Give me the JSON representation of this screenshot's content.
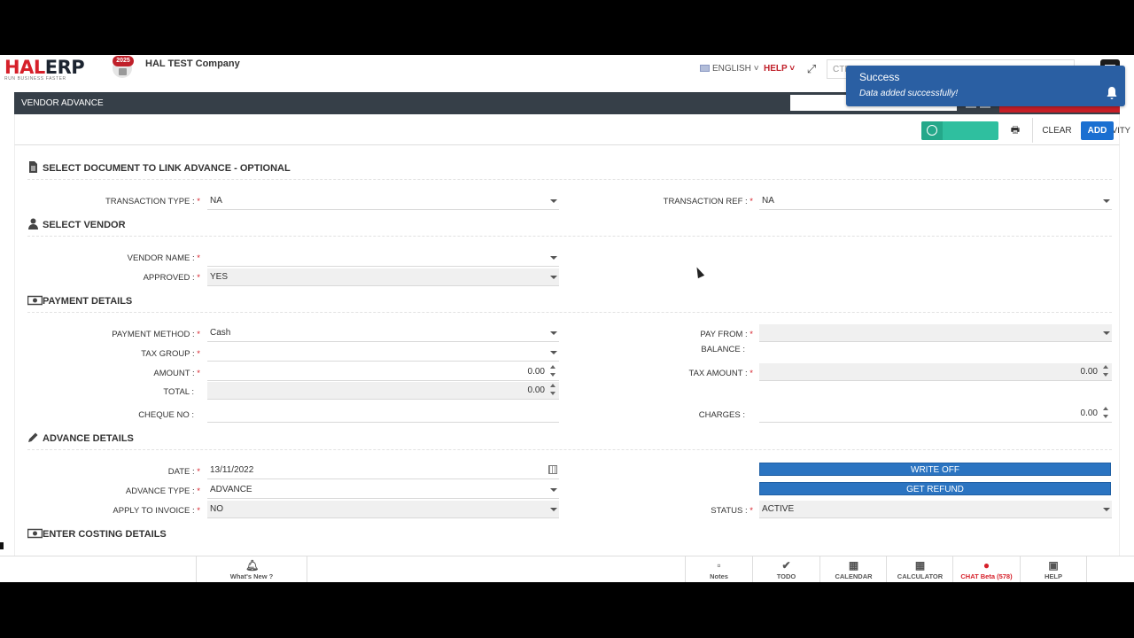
{
  "brand": {
    "logo_left": "HAL",
    "logo_right": "ERP",
    "tagline": "RUN BUSINESS FASTER",
    "year_badge": "2025",
    "company": "HAL TEST Company"
  },
  "topbar": {
    "language": "ENGLISH",
    "help": "HELP",
    "search_placeholder": "CTR"
  },
  "toast": {
    "title": "Success",
    "message": "Data added successfully!"
  },
  "module": {
    "title": "VENDOR ADVANCE"
  },
  "actions": {
    "activity": "ACTIVITY",
    "clear": "CLEAR",
    "add": "ADD"
  },
  "sections": {
    "link_doc": "SELECT DOCUMENT TO LINK ADVANCE - OPTIONAL",
    "vendor": "SELECT VENDOR",
    "payment": "PAYMENT DETAILS",
    "advance": "ADVANCE DETAILS",
    "costing": "ENTER COSTING DETAILS"
  },
  "fields": {
    "transaction_type": {
      "label": "TRANSACTION TYPE :",
      "value": "NA"
    },
    "transaction_ref": {
      "label": "TRANSACTION REF :",
      "value": "NA"
    },
    "vendor_name": {
      "label": "VENDOR NAME :",
      "value": ""
    },
    "approved": {
      "label": "APPROVED :",
      "value": "YES"
    },
    "payment_method": {
      "label": "PAYMENT METHOD :",
      "value": "Cash"
    },
    "pay_from": {
      "label": "PAY FROM :",
      "value": ""
    },
    "balance": {
      "label": "BALANCE :"
    },
    "tax_group": {
      "label": "TAX GROUP :",
      "value": ""
    },
    "amount": {
      "label": "AMOUNT :",
      "value": "0.00"
    },
    "tax_amount": {
      "label": "TAX AMOUNT :",
      "value": "0.00"
    },
    "total": {
      "label": "TOTAL :",
      "value": "0.00"
    },
    "cheque_no": {
      "label": "CHEQUE NO :",
      "value": ""
    },
    "charges": {
      "label": "CHARGES :",
      "value": "0.00"
    },
    "date": {
      "label": "DATE :",
      "value": "13/11/2022"
    },
    "advance_type": {
      "label": "ADVANCE TYPE :",
      "value": "ADVANCE"
    },
    "apply_to_invoice": {
      "label": "APPLY TO INVOICE :",
      "value": "NO"
    },
    "status": {
      "label": "STATUS :",
      "value": "ACTIVE"
    }
  },
  "buttons": {
    "write_off": "WRITE OFF",
    "get_refund": "GET REFUND"
  },
  "bottombar": {
    "whats_new": "What's New ?",
    "items": [
      "Notes",
      "TODO",
      "CALENDAR",
      "CALCULATOR",
      "CHAT Beta (578)",
      "HELP"
    ]
  },
  "colors": {
    "brand_red": "#d6202a",
    "primary_blue": "#1a6fd1",
    "toast_blue": "#2a5fa3",
    "activity_green": "#2fbf9f",
    "header_dark": "#363f48"
  }
}
